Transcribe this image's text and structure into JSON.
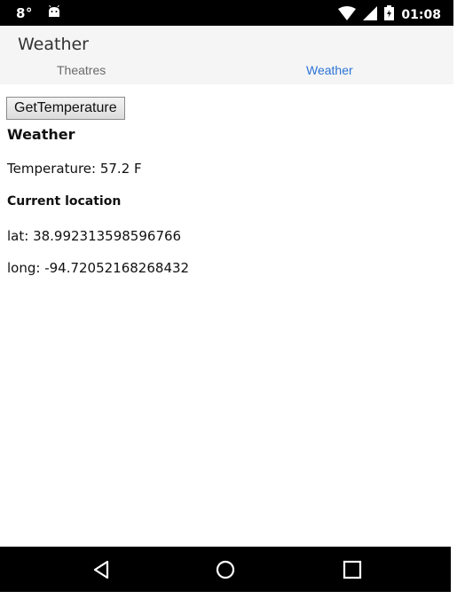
{
  "status_bar": {
    "left_label": "8°",
    "time": "01:08"
  },
  "app": {
    "title": "Weather"
  },
  "tabs": [
    {
      "label": "Theatres",
      "active": false
    },
    {
      "label": "Weather",
      "active": true
    }
  ],
  "content": {
    "button_label": "GetTemperature",
    "weather_heading": "Weather",
    "temperature_text": "Temperature: 57.2 F",
    "location_heading": "Current location",
    "lat_text": "lat: 38.992313598596766",
    "long_text": "long: -94.72052168268432"
  },
  "colors": {
    "status_bar_bg": "#000000",
    "header_bg": "#f5f5f5",
    "active_tab": "#2c74d6",
    "inactive_tab": "#6a6a6a"
  },
  "icons": {
    "status_left": [
      "android-debug-icon"
    ],
    "status_right": [
      "wifi-icon",
      "signal-icon",
      "battery-icon"
    ],
    "nav": [
      "back-icon",
      "home-icon",
      "recents-icon"
    ]
  }
}
